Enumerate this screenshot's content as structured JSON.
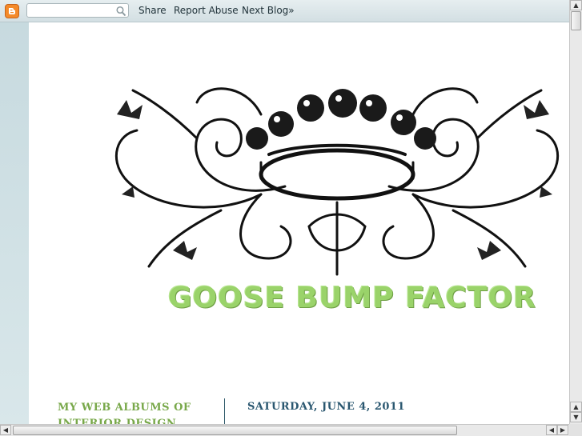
{
  "navbar": {
    "search": {
      "value": "",
      "placeholder": ""
    },
    "links": [
      {
        "label": "Share"
      },
      {
        "label": "Report Abuse"
      },
      {
        "label": "Next Blog»"
      }
    ],
    "icons": {
      "logo": "blogger-logo-icon",
      "search": "search-icon"
    },
    "colors": {
      "logo": "#f48a2a"
    }
  },
  "header": {
    "title": "GOOSE BUMP FACTOR",
    "image": "crown-and-scroll-ornament",
    "title_color": "#9ad36a"
  },
  "sidebar": {
    "heading": "MY WEB ALBUMS OF INTERIOR DESIGN JOBS"
  },
  "main": {
    "date_header": "SATURDAY, JUNE 4, 2011"
  },
  "scrollbars": {
    "up_arrow": "▲",
    "down_arrow": "▼",
    "left_arrow": "◀",
    "right_arrow": "▶"
  }
}
